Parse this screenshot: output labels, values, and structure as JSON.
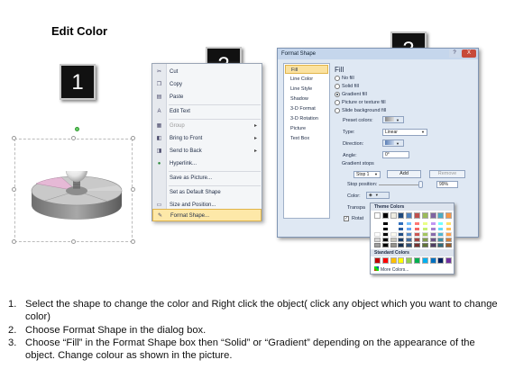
{
  "title": "Edit Color",
  "steps": {
    "one": "1",
    "two": "2",
    "three": "3"
  },
  "context_menu": {
    "items": [
      {
        "label": "Cut",
        "icon": "scissors-icon",
        "glyph": "✂"
      },
      {
        "label": "Copy",
        "icon": "copy-icon",
        "glyph": "❐"
      },
      {
        "label": "Paste",
        "icon": "paste-icon",
        "glyph": "▤"
      },
      {
        "label": "Edit Text",
        "icon": "edit-text-icon",
        "glyph": "A"
      },
      {
        "label": "Group",
        "icon": "group-icon",
        "glyph": "▦"
      },
      {
        "label": "Bring to Front",
        "icon": "bring-front-icon",
        "glyph": "◧"
      },
      {
        "label": "Send to Back",
        "icon": "send-back-icon",
        "glyph": "◨"
      },
      {
        "label": "Hyperlink...",
        "icon": "hyperlink-icon",
        "glyph": "●"
      },
      {
        "label": "Save as Picture...",
        "icon": "",
        "glyph": ""
      },
      {
        "label": "Set as Default Shape",
        "icon": "",
        "glyph": ""
      },
      {
        "label": "Size and Position...",
        "icon": "size-position-icon",
        "glyph": "▭"
      },
      {
        "label": "Format Shape...",
        "icon": "format-shape-icon",
        "glyph": "✎"
      }
    ]
  },
  "dialog": {
    "title": "Format Shape",
    "help": "?",
    "close": "X",
    "nav": [
      "Fill",
      "Line Color",
      "Line Style",
      "Shadow",
      "3-D Format",
      "3-D Rotation",
      "Picture",
      "Text Box"
    ],
    "heading": "Fill",
    "options": [
      "No fill",
      "Solid fill",
      "Gradient fill",
      "Picture or texture fill",
      "Slide background fill"
    ],
    "preset_colors": "Preset colors:",
    "type_label": "Type:",
    "type_value": "Linear",
    "direction_label": "Direction:",
    "angle_label": "Angle:",
    "angle_value": "0°",
    "gradient_stops": "Gradient stops",
    "stop_value": "Stop 1",
    "add": "Add",
    "remove": "Remove",
    "stop_position": "Stop position:",
    "stop_position_value": "99%",
    "color_label": "Color:",
    "transparency_label": "Transpa",
    "rotate_label": "Rotat"
  },
  "palette": {
    "theme_header": "Theme Colors",
    "standard_header": "Standard Colors",
    "more": "More Colors...",
    "theme_top": [
      "#ffffff",
      "#000000",
      "#eeece1",
      "#1f497d",
      "#4f81bd",
      "#c0504d",
      "#9bbb59",
      "#8064a2",
      "#4bacc6",
      "#f79646"
    ],
    "standard": [
      "#c00000",
      "#ff0000",
      "#ffc000",
      "#ffff00",
      "#92d050",
      "#00b050",
      "#00b0f0",
      "#0070c0",
      "#002060",
      "#7030a0"
    ]
  },
  "instructions": [
    {
      "num": "1.",
      "text": "Select the shape to change the color and Right click the object( click any object which you want to change color)"
    },
    {
      "num": "2.",
      "text": "Choose Format Shape in the dialog box."
    },
    {
      "num": "3.",
      "text": "Choose “Fill” in the Format Shape box then “Solid” or “Gradient” depending on the appearance of the object. Change colour as shown in the picture."
    }
  ]
}
